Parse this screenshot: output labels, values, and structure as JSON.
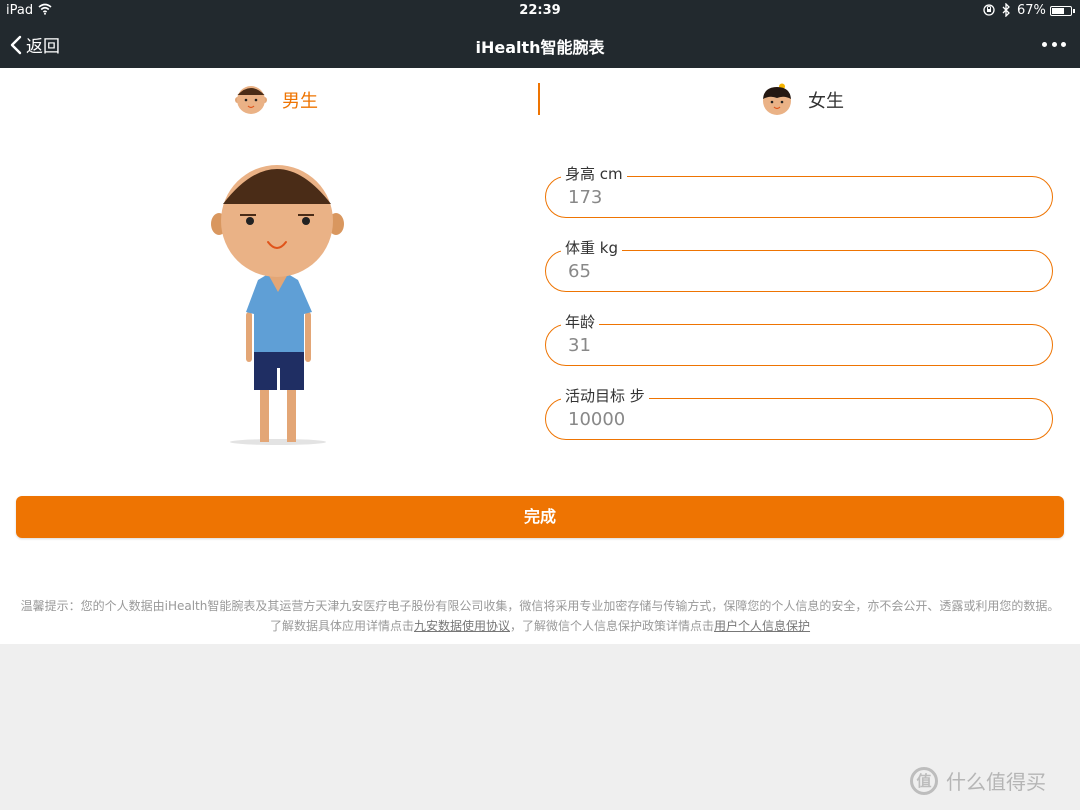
{
  "status_bar": {
    "device": "iPad",
    "time": "22:39",
    "battery_text": "67%",
    "battery_level": 0.67
  },
  "nav": {
    "back_label": "返回",
    "title": "iHealth智能腕表"
  },
  "gender_tabs": {
    "male_label": "男生",
    "female_label": "女生",
    "selected": "male"
  },
  "fields": {
    "height": {
      "label": "身高 cm",
      "value": "173"
    },
    "weight": {
      "label": "体重 kg",
      "value": "65"
    },
    "age": {
      "label": "年龄",
      "value": "31"
    },
    "goal": {
      "label": "活动目标 步",
      "value": "10000"
    }
  },
  "done_label": "完成",
  "notice": {
    "text1": "温馨提示：您的个人数据由iHealth智能腕表及其运营方天津九安医疗电子股份有限公司收集，微信将采用专业加密存储与传输方式，保障您的个人信息的安全，亦不会公开、透露或利用您的数据。了解数据具体应用详情点击",
    "link1": "九安数据使用协议",
    "text2": "，了解微信个人信息保护政策详情点击",
    "link2": "用户个人信息保护"
  },
  "watermark": {
    "icon_text": "值",
    "text": "什么值得买"
  },
  "colors": {
    "accent": "#ee7402",
    "nav_bg": "#22292e"
  }
}
